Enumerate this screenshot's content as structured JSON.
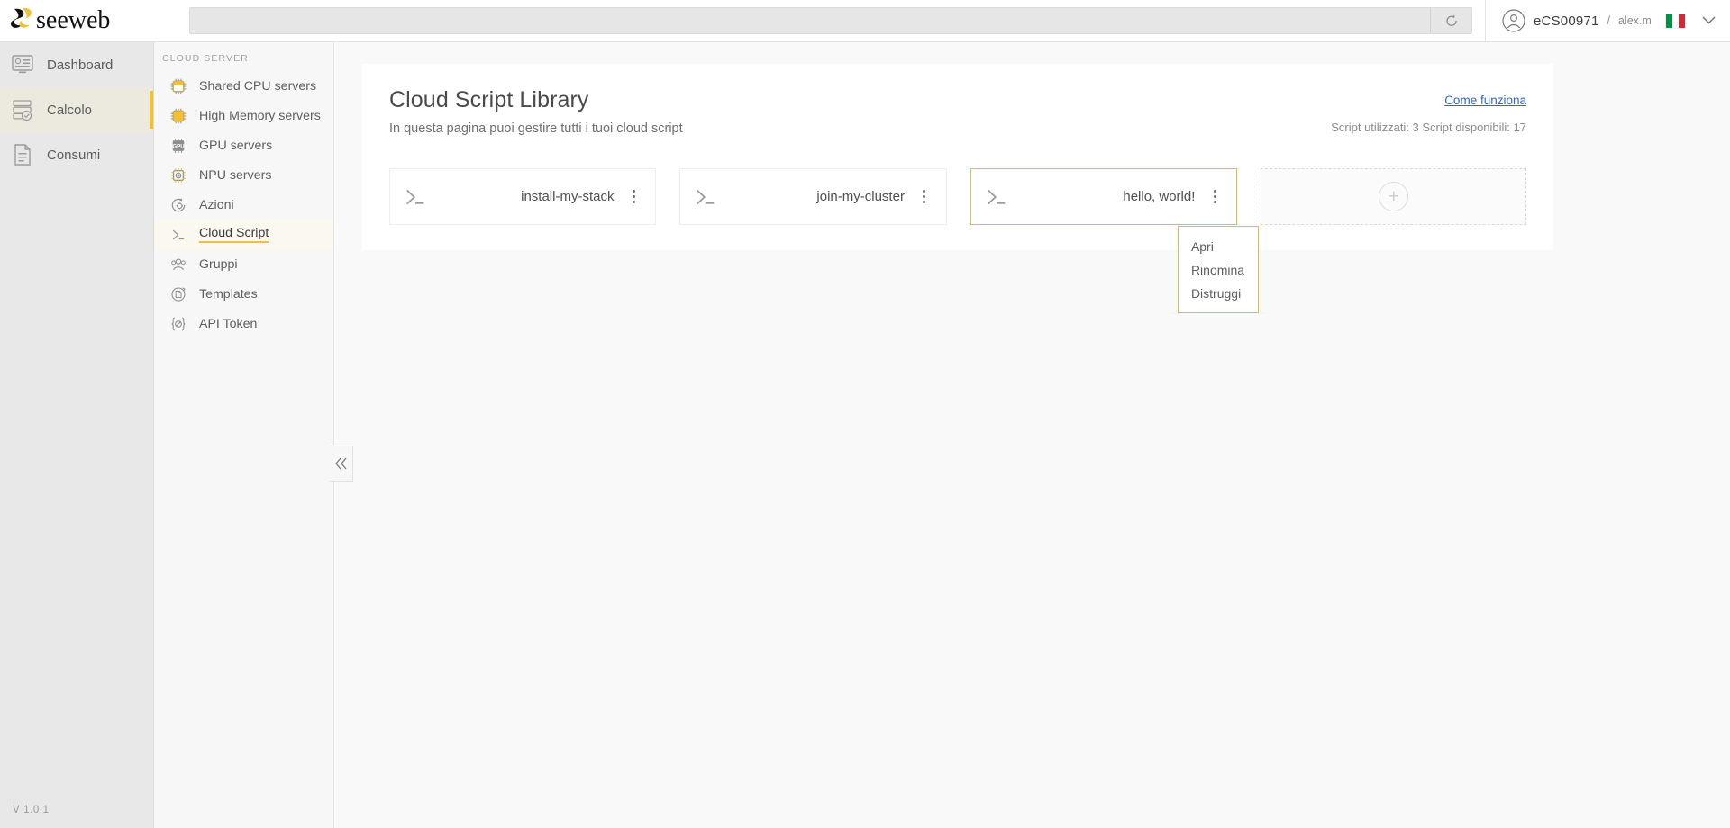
{
  "topbar": {
    "logo_text": "seeweb",
    "search_placeholder": "",
    "search_value": "",
    "refresh_icon": "refresh-icon",
    "account_id": "eCS00971",
    "account_sep": "/",
    "account_user": "alex.m",
    "flag": "italy-flag",
    "caret_icon": "chevron-down-icon"
  },
  "nav_primary": {
    "items": [
      {
        "label": "Dashboard",
        "icon": "dashboard-icon",
        "active": false
      },
      {
        "label": "Calcolo",
        "icon": "servers-icon",
        "active": true
      },
      {
        "label": "Consumi",
        "icon": "document-icon",
        "active": false
      }
    ],
    "version": "V 1.0.1"
  },
  "nav_secondary": {
    "title": "CLOUD SERVER",
    "items": [
      {
        "label": "Shared CPU servers",
        "icon": "cpu-outline-icon",
        "active": false
      },
      {
        "label": "High Memory servers",
        "icon": "cpu-filled-icon",
        "active": false
      },
      {
        "label": "GPU servers",
        "icon": "gpu-icon",
        "active": false
      },
      {
        "label": "NPU servers",
        "icon": "npu-icon",
        "active": false
      },
      {
        "label": "Azioni",
        "icon": "actions-gear-icon",
        "active": false
      },
      {
        "label": "Cloud Script",
        "icon": "terminal-icon",
        "active": true
      },
      {
        "label": "Gruppi",
        "icon": "groups-icon",
        "active": false
      },
      {
        "label": "Templates",
        "icon": "templates-icon",
        "active": false
      },
      {
        "label": "API Token",
        "icon": "api-token-icon",
        "active": false
      }
    ],
    "collapse_icon": "double-chevron-left-icon"
  },
  "page": {
    "title": "Cloud Script Library",
    "subtitle": "In questa pagina puoi gestire tutti i tuoi cloud script",
    "how_it_works": "Come funziona",
    "quota": "Script utilizzati: 3 Script disponibili: 17",
    "accent_color": "#f2c037",
    "link_color": "#3366cc"
  },
  "scripts": [
    {
      "name": "install-my-stack",
      "icon": "terminal-prompt-icon",
      "selected": false
    },
    {
      "name": "join-my-cluster",
      "icon": "terminal-prompt-icon",
      "selected": false
    },
    {
      "name": "hello, world!",
      "icon": "terminal-prompt-icon",
      "selected": true
    }
  ],
  "add_card": {
    "icon": "plus-icon"
  },
  "context_menu": {
    "visible": true,
    "items": [
      {
        "label": "Apri"
      },
      {
        "label": "Rinomina"
      },
      {
        "label": "Distruggi"
      }
    ]
  }
}
